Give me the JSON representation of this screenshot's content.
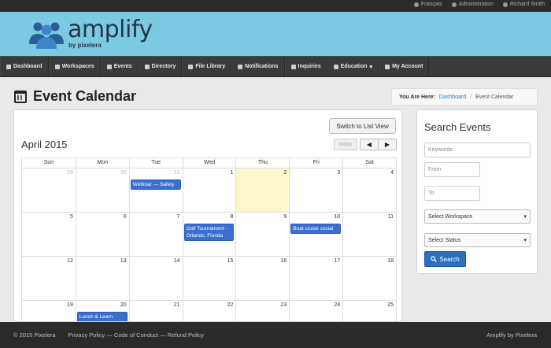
{
  "topbar": {
    "links": [
      {
        "label": "Français",
        "icon": "globe-icon"
      },
      {
        "label": "Administration",
        "icon": "gear-icon"
      },
      {
        "label": "Richard Smith",
        "icon": "gear-icon"
      }
    ]
  },
  "brand": {
    "name": "amplify",
    "tagline": "by pixelera"
  },
  "nav": [
    {
      "label": "Dashboard",
      "icon": "dashboard-icon"
    },
    {
      "label": "Workspaces",
      "icon": "grid-icon"
    },
    {
      "label": "Events",
      "icon": "calendar-icon"
    },
    {
      "label": "Directory",
      "icon": "users-icon"
    },
    {
      "label": "File Library",
      "icon": "file-icon"
    },
    {
      "label": "Notifications",
      "icon": "envelope-icon"
    },
    {
      "label": "Inquiries",
      "icon": "question-icon"
    },
    {
      "label": "Education",
      "icon": "book-icon",
      "caret": "▾"
    },
    {
      "label": "My Account",
      "icon": "user-icon"
    }
  ],
  "page": {
    "title": "Event Calendar"
  },
  "breadcrumb": {
    "label": "You Are Here:",
    "link": "Dashboard",
    "sep": "/",
    "current": "Event Calendar"
  },
  "calendar": {
    "switch_label": "Switch to List View",
    "month": "April 2015",
    "today_label": "today",
    "prev": "◀",
    "next": "▶",
    "weekdays": [
      "Sun",
      "Mon",
      "Tue",
      "Wed",
      "Thu",
      "Fri",
      "Sat"
    ],
    "weeks": [
      [
        {
          "n": "29",
          "other": true
        },
        {
          "n": "30",
          "other": true
        },
        {
          "n": "31",
          "other": true,
          "event": "Webinar — Safety"
        },
        {
          "n": "1"
        },
        {
          "n": "2",
          "today": true
        },
        {
          "n": "3"
        },
        {
          "n": "4"
        }
      ],
      [
        {
          "n": "5"
        },
        {
          "n": "6"
        },
        {
          "n": "7"
        },
        {
          "n": "8",
          "event": "Golf Tournament - Orlando, Florida"
        },
        {
          "n": "9"
        },
        {
          "n": "10",
          "event": "Boat cruise social"
        },
        {
          "n": "11"
        }
      ],
      [
        {
          "n": "12"
        },
        {
          "n": "13"
        },
        {
          "n": "14"
        },
        {
          "n": "15"
        },
        {
          "n": "16"
        },
        {
          "n": "17"
        },
        {
          "n": "18"
        }
      ],
      [
        {
          "n": "19"
        },
        {
          "n": "20",
          "event": "Lunch & Learn"
        },
        {
          "n": "21"
        },
        {
          "n": "22"
        },
        {
          "n": "23"
        },
        {
          "n": "24"
        },
        {
          "n": "25"
        }
      ]
    ]
  },
  "search": {
    "title": "Search Events",
    "keywords_placeholder": "Keywords",
    "from_placeholder": "From",
    "to_placeholder": "To",
    "workspace_select": "Select Workspace",
    "status_select": "Select Status",
    "button_label": "Search"
  },
  "footer": {
    "copyright": "© 2015 Pixelera",
    "links": "Privacy Policy — Code of Conduct — Refund Policy",
    "right": "Amplify by Pixelera"
  }
}
